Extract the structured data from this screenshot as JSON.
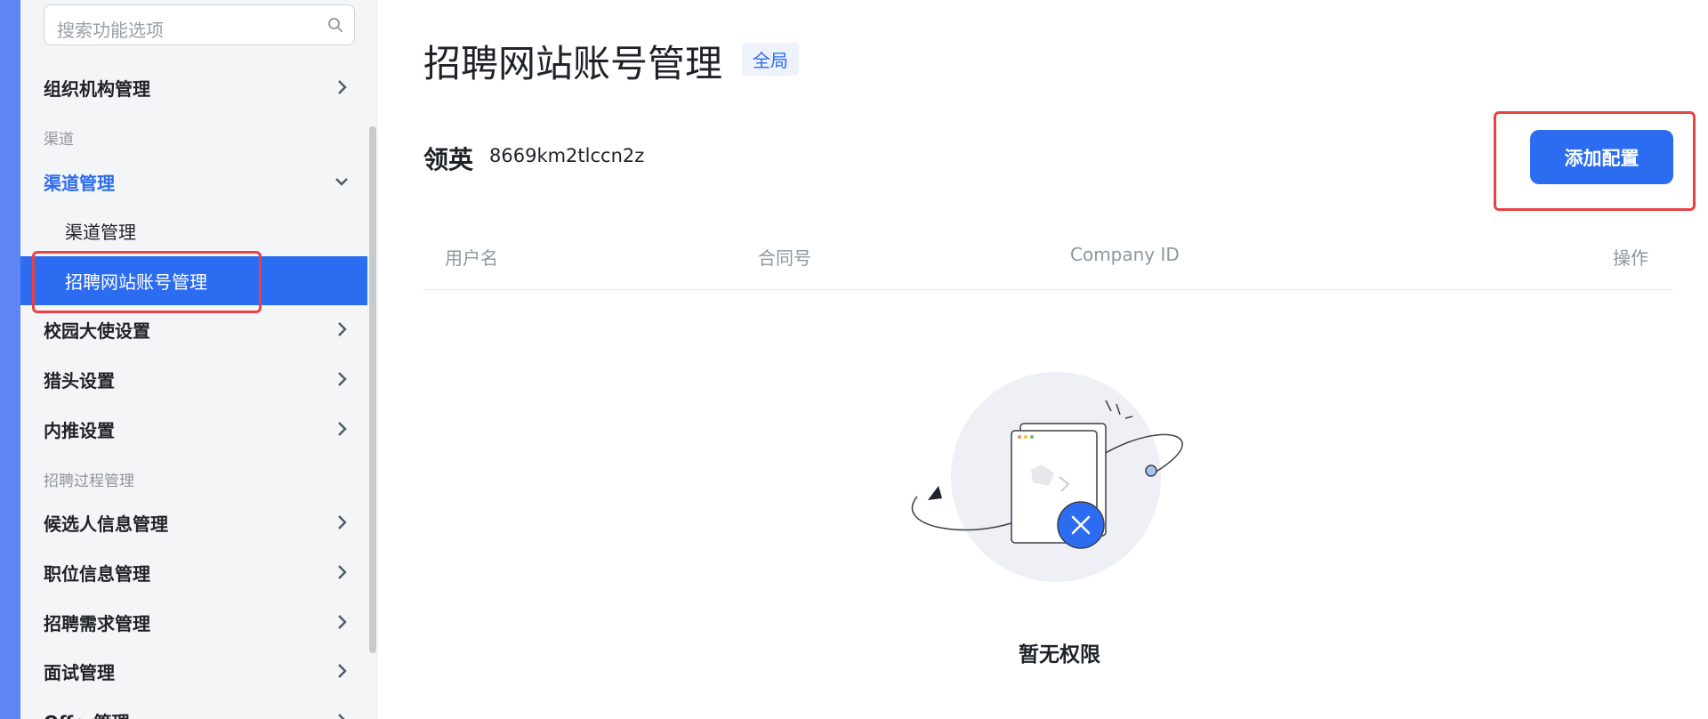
{
  "sidebar": {
    "search_placeholder": "搜索功能选项",
    "items": [
      {
        "label": "组织机构管理"
      },
      {
        "section": "渠道"
      },
      {
        "label": "渠道管理"
      },
      {
        "label": "渠道管理"
      },
      {
        "label": "招聘网站账号管理"
      },
      {
        "label": "校园大使设置"
      },
      {
        "label": "猎头设置"
      },
      {
        "label": "内推设置"
      },
      {
        "section": "招聘过程管理"
      },
      {
        "label": "候选人信息管理"
      },
      {
        "label": "职位信息管理"
      },
      {
        "label": "招聘需求管理"
      },
      {
        "label": "面试管理"
      },
      {
        "label": "Offer管理"
      }
    ]
  },
  "page": {
    "title": "招聘网站账号管理",
    "scope_badge": "全局",
    "brand": "领英",
    "account_id": "8669km2tlccn2z",
    "add_button": "添加配置"
  },
  "table": {
    "columns": [
      "用户名",
      "合同号",
      "Company ID",
      "操作"
    ]
  },
  "empty_state": {
    "message": "暂无权限"
  },
  "colors": {
    "accent": "#2b6cf0",
    "highlight": "#e84242"
  }
}
